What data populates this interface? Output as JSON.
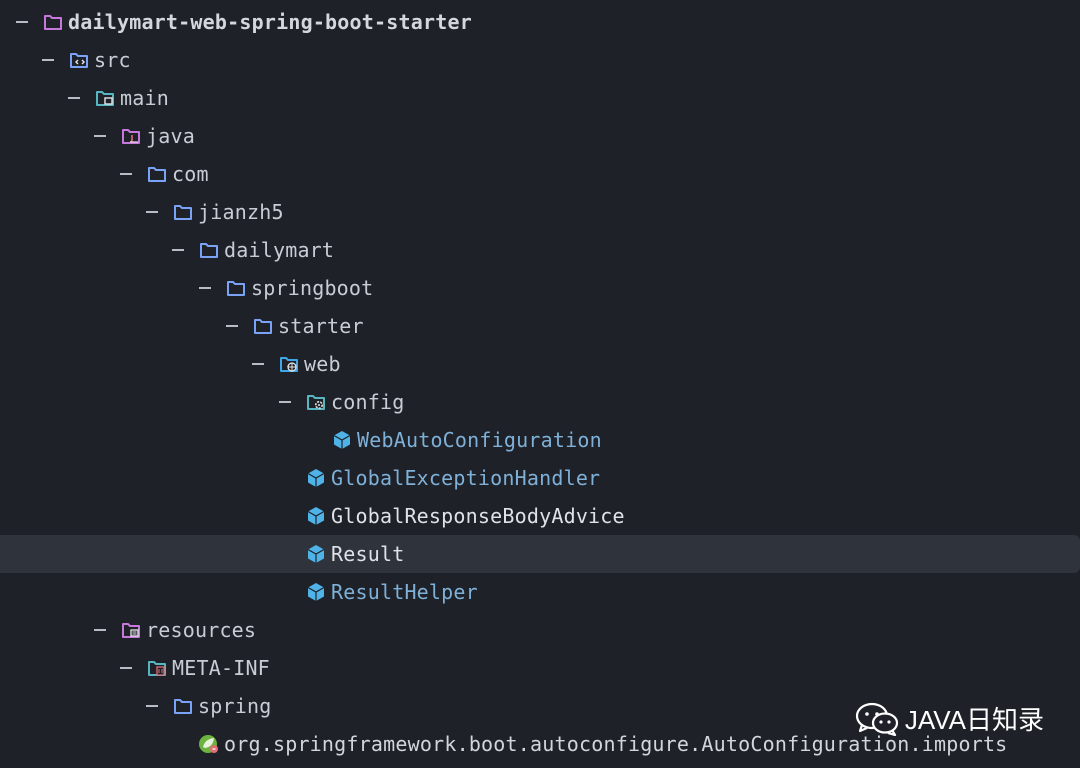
{
  "tree": {
    "nodes": [
      {
        "label": "dailymart-web-spring-boot-starter",
        "icon": "folder-icon",
        "color": "#c678dd"
      },
      {
        "label": "src",
        "icon": "source-folder-icon",
        "color": "#7aa2f7"
      },
      {
        "label": "main",
        "icon": "main-folder-icon",
        "color": "#56b6c2"
      },
      {
        "label": "java",
        "icon": "java-folder-icon",
        "color": "#c678dd"
      },
      {
        "label": "com",
        "icon": "package-folder-icon",
        "color": "#7aa2f7"
      },
      {
        "label": "jianzh5",
        "icon": "package-folder-icon",
        "color": "#7aa2f7"
      },
      {
        "label": "dailymart",
        "icon": "package-folder-icon",
        "color": "#7aa2f7"
      },
      {
        "label": "springboot",
        "icon": "package-folder-icon",
        "color": "#7aa2f7"
      },
      {
        "label": "starter",
        "icon": "package-folder-icon",
        "color": "#7aa2f7"
      },
      {
        "label": "web",
        "icon": "web-folder-icon",
        "color": "#3fa7e8"
      },
      {
        "label": "config",
        "icon": "config-folder-icon",
        "color": "#56b6c2"
      },
      {
        "label": "WebAutoConfiguration",
        "icon": "class-icon",
        "color": "#4fb3e8"
      },
      {
        "label": "GlobalExceptionHandler",
        "icon": "class-icon",
        "color": "#4fb3e8"
      },
      {
        "label": "GlobalResponseBodyAdvice",
        "icon": "class-icon",
        "color": "#4fb3e8"
      },
      {
        "label": "Result",
        "icon": "class-icon",
        "color": "#4fb3e8"
      },
      {
        "label": "ResultHelper",
        "icon": "class-icon",
        "color": "#4fb3e8"
      },
      {
        "label": "resources",
        "icon": "resources-folder-icon",
        "color": "#c678dd"
      },
      {
        "label": "META-INF",
        "icon": "meta-inf-folder-icon",
        "color": "#56b6c2"
      },
      {
        "label": "spring",
        "icon": "package-folder-icon",
        "color": "#7aa2f7"
      },
      {
        "label": "org.springframework.boot.autoconfigure.AutoConfiguration.imports",
        "icon": "spring-file-icon",
        "color": "#6db33f"
      }
    ]
  },
  "watermark": {
    "text": "JAVA日知录",
    "icon": "wechat-icon"
  }
}
